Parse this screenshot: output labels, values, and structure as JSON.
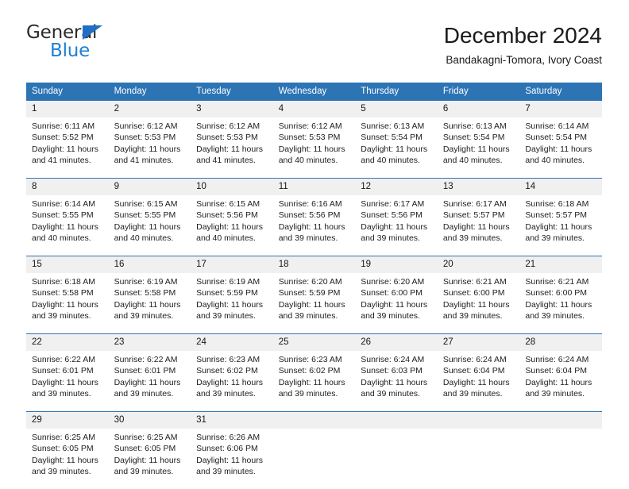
{
  "brand": {
    "line1": "General",
    "line2": "Blue",
    "triangle_color": "#1f6fc4",
    "blue_color": "#1f7fd4"
  },
  "header": {
    "title": "December 2024",
    "subtitle": "Bandakagni-Tomora, Ivory Coast"
  },
  "theme": {
    "header_blue": "#2d74b5",
    "daynum_gray": "#f0f0f0",
    "text": "#1d1d1d"
  },
  "calendar": {
    "weekday_headers": [
      "Sunday",
      "Monday",
      "Tuesday",
      "Wednesday",
      "Thursday",
      "Friday",
      "Saturday"
    ],
    "weeks": [
      [
        {
          "day": "1",
          "sunrise": "Sunrise: 6:11 AM",
          "sunset": "Sunset: 5:52 PM",
          "daylight": "Daylight: 11 hours and 41 minutes."
        },
        {
          "day": "2",
          "sunrise": "Sunrise: 6:12 AM",
          "sunset": "Sunset: 5:53 PM",
          "daylight": "Daylight: 11 hours and 41 minutes."
        },
        {
          "day": "3",
          "sunrise": "Sunrise: 6:12 AM",
          "sunset": "Sunset: 5:53 PM",
          "daylight": "Daylight: 11 hours and 41 minutes."
        },
        {
          "day": "4",
          "sunrise": "Sunrise: 6:12 AM",
          "sunset": "Sunset: 5:53 PM",
          "daylight": "Daylight: 11 hours and 40 minutes."
        },
        {
          "day": "5",
          "sunrise": "Sunrise: 6:13 AM",
          "sunset": "Sunset: 5:54 PM",
          "daylight": "Daylight: 11 hours and 40 minutes."
        },
        {
          "day": "6",
          "sunrise": "Sunrise: 6:13 AM",
          "sunset": "Sunset: 5:54 PM",
          "daylight": "Daylight: 11 hours and 40 minutes."
        },
        {
          "day": "7",
          "sunrise": "Sunrise: 6:14 AM",
          "sunset": "Sunset: 5:54 PM",
          "daylight": "Daylight: 11 hours and 40 minutes."
        }
      ],
      [
        {
          "day": "8",
          "sunrise": "Sunrise: 6:14 AM",
          "sunset": "Sunset: 5:55 PM",
          "daylight": "Daylight: 11 hours and 40 minutes."
        },
        {
          "day": "9",
          "sunrise": "Sunrise: 6:15 AM",
          "sunset": "Sunset: 5:55 PM",
          "daylight": "Daylight: 11 hours and 40 minutes."
        },
        {
          "day": "10",
          "sunrise": "Sunrise: 6:15 AM",
          "sunset": "Sunset: 5:56 PM",
          "daylight": "Daylight: 11 hours and 40 minutes."
        },
        {
          "day": "11",
          "sunrise": "Sunrise: 6:16 AM",
          "sunset": "Sunset: 5:56 PM",
          "daylight": "Daylight: 11 hours and 39 minutes."
        },
        {
          "day": "12",
          "sunrise": "Sunrise: 6:17 AM",
          "sunset": "Sunset: 5:56 PM",
          "daylight": "Daylight: 11 hours and 39 minutes."
        },
        {
          "day": "13",
          "sunrise": "Sunrise: 6:17 AM",
          "sunset": "Sunset: 5:57 PM",
          "daylight": "Daylight: 11 hours and 39 minutes."
        },
        {
          "day": "14",
          "sunrise": "Sunrise: 6:18 AM",
          "sunset": "Sunset: 5:57 PM",
          "daylight": "Daylight: 11 hours and 39 minutes."
        }
      ],
      [
        {
          "day": "15",
          "sunrise": "Sunrise: 6:18 AM",
          "sunset": "Sunset: 5:58 PM",
          "daylight": "Daylight: 11 hours and 39 minutes."
        },
        {
          "day": "16",
          "sunrise": "Sunrise: 6:19 AM",
          "sunset": "Sunset: 5:58 PM",
          "daylight": "Daylight: 11 hours and 39 minutes."
        },
        {
          "day": "17",
          "sunrise": "Sunrise: 6:19 AM",
          "sunset": "Sunset: 5:59 PM",
          "daylight": "Daylight: 11 hours and 39 minutes."
        },
        {
          "day": "18",
          "sunrise": "Sunrise: 6:20 AM",
          "sunset": "Sunset: 5:59 PM",
          "daylight": "Daylight: 11 hours and 39 minutes."
        },
        {
          "day": "19",
          "sunrise": "Sunrise: 6:20 AM",
          "sunset": "Sunset: 6:00 PM",
          "daylight": "Daylight: 11 hours and 39 minutes."
        },
        {
          "day": "20",
          "sunrise": "Sunrise: 6:21 AM",
          "sunset": "Sunset: 6:00 PM",
          "daylight": "Daylight: 11 hours and 39 minutes."
        },
        {
          "day": "21",
          "sunrise": "Sunrise: 6:21 AM",
          "sunset": "Sunset: 6:00 PM",
          "daylight": "Daylight: 11 hours and 39 minutes."
        }
      ],
      [
        {
          "day": "22",
          "sunrise": "Sunrise: 6:22 AM",
          "sunset": "Sunset: 6:01 PM",
          "daylight": "Daylight: 11 hours and 39 minutes."
        },
        {
          "day": "23",
          "sunrise": "Sunrise: 6:22 AM",
          "sunset": "Sunset: 6:01 PM",
          "daylight": "Daylight: 11 hours and 39 minutes."
        },
        {
          "day": "24",
          "sunrise": "Sunrise: 6:23 AM",
          "sunset": "Sunset: 6:02 PM",
          "daylight": "Daylight: 11 hours and 39 minutes."
        },
        {
          "day": "25",
          "sunrise": "Sunrise: 6:23 AM",
          "sunset": "Sunset: 6:02 PM",
          "daylight": "Daylight: 11 hours and 39 minutes."
        },
        {
          "day": "26",
          "sunrise": "Sunrise: 6:24 AM",
          "sunset": "Sunset: 6:03 PM",
          "daylight": "Daylight: 11 hours and 39 minutes."
        },
        {
          "day": "27",
          "sunrise": "Sunrise: 6:24 AM",
          "sunset": "Sunset: 6:04 PM",
          "daylight": "Daylight: 11 hours and 39 minutes."
        },
        {
          "day": "28",
          "sunrise": "Sunrise: 6:24 AM",
          "sunset": "Sunset: 6:04 PM",
          "daylight": "Daylight: 11 hours and 39 minutes."
        }
      ],
      [
        {
          "day": "29",
          "sunrise": "Sunrise: 6:25 AM",
          "sunset": "Sunset: 6:05 PM",
          "daylight": "Daylight: 11 hours and 39 minutes."
        },
        {
          "day": "30",
          "sunrise": "Sunrise: 6:25 AM",
          "sunset": "Sunset: 6:05 PM",
          "daylight": "Daylight: 11 hours and 39 minutes."
        },
        {
          "day": "31",
          "sunrise": "Sunrise: 6:26 AM",
          "sunset": "Sunset: 6:06 PM",
          "daylight": "Daylight: 11 hours and 39 minutes."
        },
        {
          "day": "",
          "sunrise": "",
          "sunset": "",
          "daylight": ""
        },
        {
          "day": "",
          "sunrise": "",
          "sunset": "",
          "daylight": ""
        },
        {
          "day": "",
          "sunrise": "",
          "sunset": "",
          "daylight": ""
        },
        {
          "day": "",
          "sunrise": "",
          "sunset": "",
          "daylight": ""
        }
      ]
    ]
  }
}
